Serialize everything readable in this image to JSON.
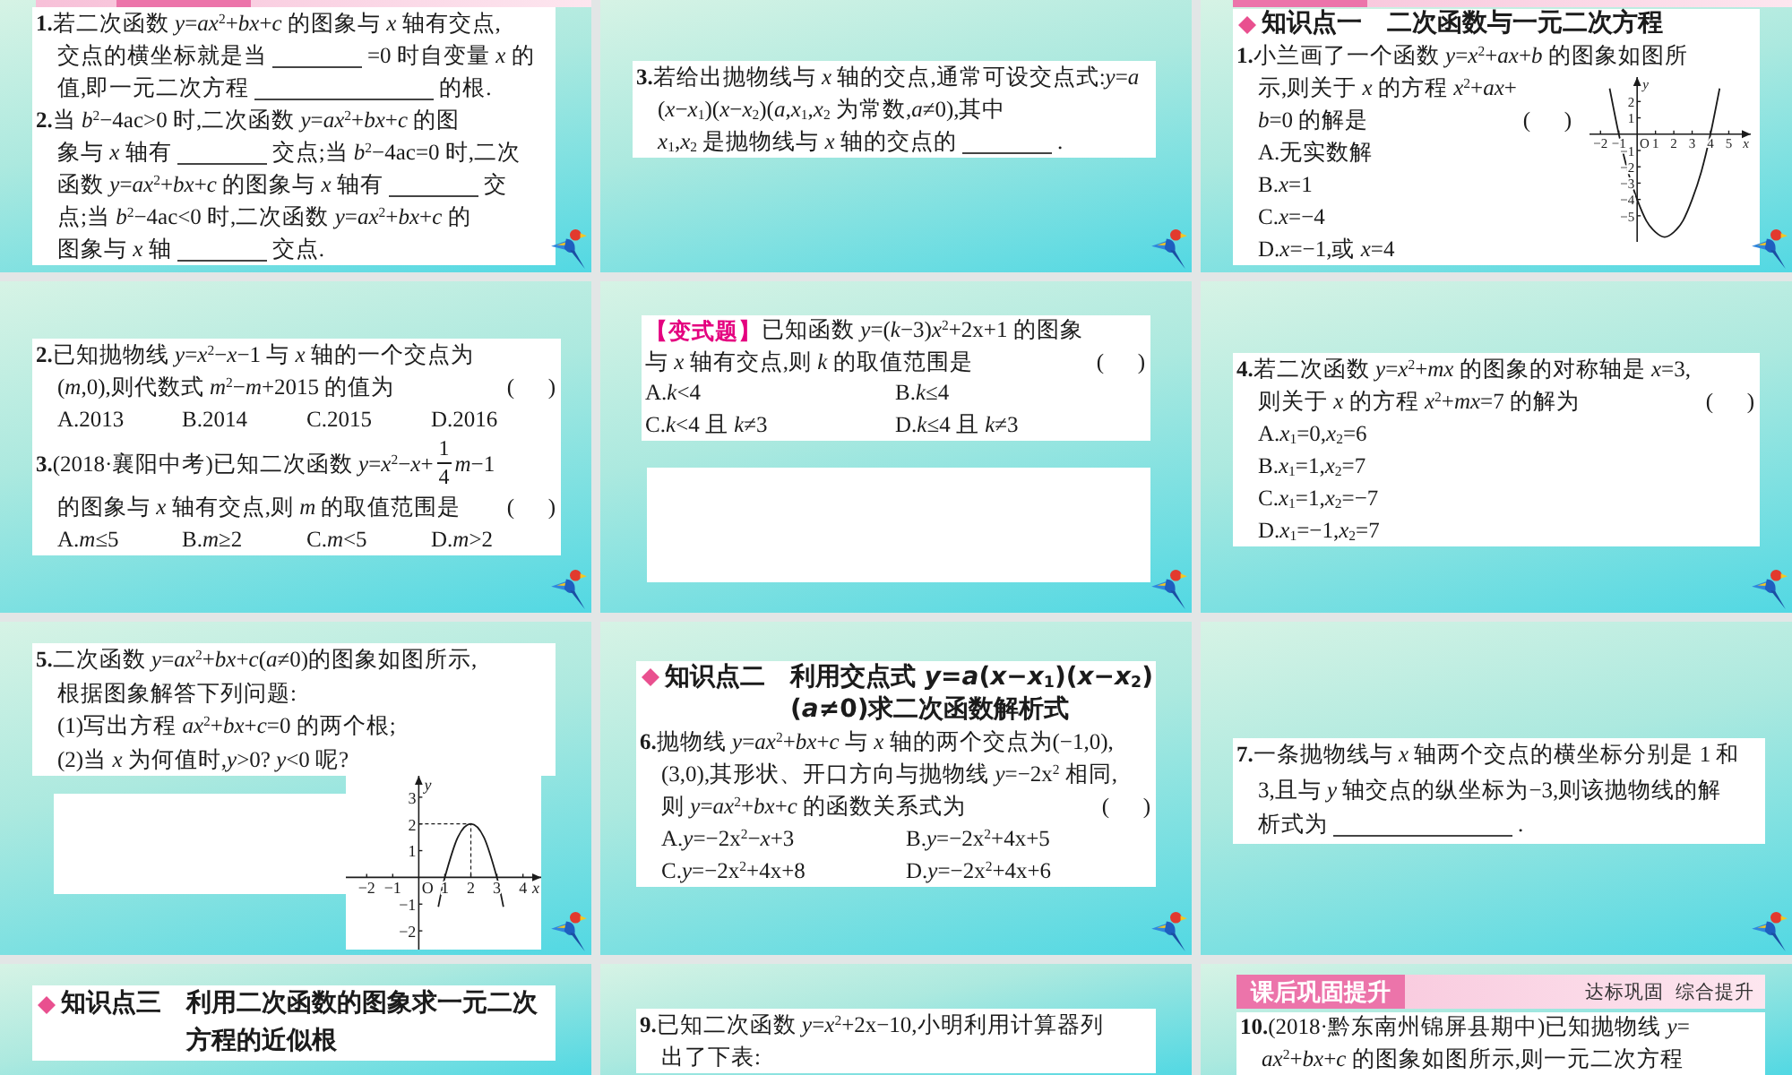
{
  "slides": [
    {
      "logo": true,
      "blocks": [
        {
          "kind": "banner"
        },
        {
          "kind": "panel",
          "items": [
            {
              "kind": "question",
              "lines": [
                {
                  "kind": "text",
                  "text": "**1.**若二次函数 *y*=*ax*$^{2}$+*bx*+*c* 的图象与 *x* 轴有交点,"
                },
                {
                  "kind": "parts",
                  "parts": [
                    {
                      "kind": "text",
                      "text": "交点的横坐标就是当"
                    },
                    {
                      "kind": "blank"
                    },
                    {
                      "kind": "text",
                      "text": "=0 时自变量 *x* 的"
                    }
                  ]
                },
                {
                  "kind": "parts",
                  "parts": [
                    {
                      "kind": "text",
                      "text": "值,即一元二次方程"
                    },
                    {
                      "kind": "longblank"
                    },
                    {
                      "kind": "text",
                      "text": "的根."
                    }
                  ]
                }
              ]
            },
            {
              "kind": "question",
              "lines": [
                {
                  "kind": "text",
                  "text": "**2.**当 *b*$^{2}$−4ac>0 时,二次函数 *y*=*ax*$^{2}$+*bx*+*c* 的图"
                },
                {
                  "kind": "parts",
                  "parts": [
                    {
                      "kind": "text",
                      "text": "象与 *x* 轴有"
                    },
                    {
                      "kind": "blank"
                    },
                    {
                      "kind": "text",
                      "text": "交点;当 *b*$^{2}$−4ac=0 时,二次"
                    }
                  ]
                },
                {
                  "kind": "parts",
                  "parts": [
                    {
                      "kind": "text",
                      "text": "函数 *y*=*ax*$^{2}$+*bx*+*c* 的图象与 *x* 轴有"
                    },
                    {
                      "kind": "blank"
                    },
                    {
                      "kind": "text",
                      "text": "交"
                    }
                  ]
                },
                {
                  "kind": "text",
                  "text": "点;当 *b*$^{2}$−4ac<0 时,二次函数 *y*=*ax*$^{2}$+*bx*+*c* 的"
                },
                {
                  "kind": "parts",
                  "parts": [
                    {
                      "kind": "text",
                      "text": "图象与 *x* 轴"
                    },
                    {
                      "kind": "blank"
                    },
                    {
                      "kind": "text",
                      "text": "交点."
                    }
                  ]
                }
              ]
            }
          ]
        }
      ]
    },
    {
      "logo": true,
      "blocks": [
        {
          "kind": "panel",
          "items": [
            {
              "kind": "question",
              "lines": [
                {
                  "kind": "text",
                  "text": "**3.**若给出抛物线与 *x* 轴的交点,通常可设交点式:*y*=*a*"
                },
                {
                  "kind": "text",
                  "text": "(*x*−*x*$_{1}$)(*x*−*x*$_{2}$)(*a*,*x*$_{1}$,*x*$_{2}$ 为常数,*a*≠0),其中"
                },
                {
                  "kind": "parts",
                  "parts": [
                    {
                      "kind": "text",
                      "text": "*x*$_{1}$,*x*$_{2}$ 是抛物线与 *x* 轴的交点的"
                    },
                    {
                      "kind": "blank"
                    },
                    {
                      "kind": "text",
                      "text": "."
                    }
                  ]
                }
              ]
            }
          ]
        }
      ]
    },
    {
      "logo": true,
      "blocks": [
        {
          "kind": "banner"
        },
        {
          "kind": "panel",
          "items": [
            {
              "kind": "heading",
              "label": "知识点一",
              "title": [
                "二次函数与一元二次方程"
              ]
            },
            {
              "kind": "question",
              "lines": [
                {
                  "kind": "text",
                  "text": "**1.**小兰画了一个函数 *y*=*x*$^{2}$+*ax*+*b* 的图象如图所"
                },
                {
                  "kind": "text",
                  "text": "示,则关于 *x* 的方程 *x*$^{2}$+*ax*+"
                },
                {
                  "kind": "choice",
                  "text": "*b*=0 的解是",
                  "bracket": "(      )"
                },
                {
                  "kind": "options",
                  "options": [
                    "A.无实数解"
                  ]
                },
                {
                  "kind": "options",
                  "options": [
                    "B.*x*=1"
                  ]
                },
                {
                  "kind": "options",
                  "options": [
                    "C.*x*=−4"
                  ]
                },
                {
                  "kind": "options",
                  "options": [
                    "D.*x*=−1,或 *x*=4"
                  ]
                }
              ],
              "figure": {
                "chart_data": {
                  "type": "line",
                  "xlabel": "x",
                  "ylabel": "y",
                  "x": [
                    -1.5,
                    -1,
                    -0.5,
                    0,
                    0.5,
                    1,
                    1.5,
                    2,
                    2.5,
                    3,
                    3.5,
                    4,
                    4.5
                  ],
                  "values": [
                    2.8,
                    0,
                    -2.3,
                    -4,
                    -5.3,
                    -6,
                    -6.3,
                    -6,
                    -5.3,
                    -4,
                    -2.3,
                    0,
                    2.8
                  ],
                  "xlim": [
                    -2.6,
                    6.2
                  ],
                  "ylim": [
                    -6.6,
                    3.5
                  ],
                  "xticks": [
                    {
                      "value": -2,
                      "label": "−2"
                    },
                    {
                      "value": -1,
                      "label": "−1"
                    },
                    {
                      "value": 0,
                      "label": "O"
                    },
                    {
                      "value": 1,
                      "label": "1"
                    },
                    {
                      "value": 2,
                      "label": "2"
                    },
                    {
                      "value": 3,
                      "label": "3"
                    },
                    {
                      "value": 4,
                      "label": "4"
                    },
                    {
                      "value": 5,
                      "label": "5"
                    }
                  ],
                  "yticks": [
                    {
                      "value": 2,
                      "label": "2"
                    },
                    {
                      "value": 1,
                      "label": "1"
                    },
                    {
                      "value": -1,
                      "label": "−1"
                    },
                    {
                      "value": -2,
                      "label": "−2"
                    },
                    {
                      "value": -3,
                      "label": "−3"
                    },
                    {
                      "value": -4,
                      "label": "−4"
                    },
                    {
                      "value": -5,
                      "label": "−5"
                    }
                  ]
                }
              }
            }
          ]
        }
      ]
    },
    {
      "logo": true,
      "blocks": [
        {
          "kind": "panel",
          "items": [
            {
              "kind": "question",
              "lines": [
                {
                  "kind": "text",
                  "text": "**2.**已知抛物线 *y*=*x*$^{2}$−*x*−1 与 *x* 轴的一个交点为"
                },
                {
                  "kind": "choice",
                  "text": "(*m*,0),则代数式 *m*$^{2}$−*m*+2015 的值为",
                  "bracket": "(      )"
                },
                {
                  "kind": "options",
                  "options": [
                    "A.2013",
                    "B.2014",
                    "C.2015",
                    "D.2016"
                  ]
                }
              ]
            },
            {
              "kind": "question",
              "lines": [
                {
                  "kind": "parts",
                  "parts": [
                    {
                      "kind": "text",
                      "text": "**3.**(2018·襄阳中考)已知二次函数 *y*=*x*$^{2}$−*x*+"
                    },
                    {
                      "kind": "fraction",
                      "numerator": "1",
                      "denominator": "4"
                    },
                    {
                      "kind": "text",
                      "text": "*m*−1"
                    }
                  ]
                },
                {
                  "kind": "choice",
                  "text": "的图象与 *x* 轴有交点,则 *m* 的取值范围是",
                  "bracket": "(      )"
                },
                {
                  "kind": "options",
                  "options": [
                    "A.*m*≤5",
                    "B.*m*≥2",
                    "C.*m*<5",
                    "D.*m*>2"
                  ]
                }
              ]
            }
          ]
        }
      ]
    },
    {
      "logo": true,
      "blocks": [
        {
          "kind": "panel",
          "items": [
            {
              "kind": "variant",
              "tag": "【变式题】",
              "lines": [
                {
                  "kind": "text",
                  "text": "已知函数 *y*=(*k*−3)*x*$^{2}$+2x+1 的图象"
                },
                {
                  "kind": "choice",
                  "text": "与 *x* 轴有交点,则 *k* 的取值范围是",
                  "bracket": "(      )"
                },
                {
                  "kind": "options",
                  "options": [
                    "A.*k*<4",
                    "B.*k*≤4"
                  ]
                },
                {
                  "kind": "options",
                  "options": [
                    "C.*k*<4 且 *k*≠3",
                    "D.*k*≤4 且 *k*≠3"
                  ]
                }
              ]
            }
          ]
        },
        {
          "kind": "answer-box"
        }
      ]
    },
    {
      "logo": true,
      "blocks": [
        {
          "kind": "panel",
          "items": [
            {
              "kind": "question",
              "lines": [
                {
                  "kind": "text",
                  "text": "**4.**若二次函数 *y*=*x*$^{2}$+*mx* 的图象的对称轴是 *x*=3,"
                },
                {
                  "kind": "choice",
                  "text": "则关于 *x* 的方程 *x*$^{2}$+*mx*=7 的解为",
                  "bracket": "(      )"
                },
                {
                  "kind": "options",
                  "options": [
                    "A.*x*$_{1}$=0,*x*$_{2}$=6"
                  ]
                },
                {
                  "kind": "options",
                  "options": [
                    "B.*x*$_{1}$=1,*x*$_{2}$=7"
                  ]
                },
                {
                  "kind": "options",
                  "options": [
                    "C.*x*$_{1}$=1,*x*$_{2}$=−7"
                  ]
                },
                {
                  "kind": "options",
                  "options": [
                    "D.*x*$_{1}$=−1,*x*$_{2}$=7"
                  ]
                }
              ]
            }
          ]
        }
      ]
    },
    {
      "logo": true,
      "blocks": [
        {
          "kind": "panel",
          "items": [
            {
              "kind": "question",
              "lines": [
                {
                  "kind": "text",
                  "text": "**5.**二次函数 *y*=*ax*$^{2}$+*bx*+*c*(*a*≠0)的图象如图所示,"
                },
                {
                  "kind": "text",
                  "text": "根据图象解答下列问题:"
                },
                {
                  "kind": "text",
                  "text": "(1)写出方程 *ax*$^{2}$+*bx*+*c*=0 的两个根;"
                },
                {
                  "kind": "text",
                  "text": "(2)当 *x* 为何值时,*y*>0? *y*<0 呢?"
                }
              ]
            }
          ]
        },
        {
          "kind": "work",
          "figure": {
            "chart_data": {
              "type": "line",
              "xlabel": "x",
              "ylabel": "y",
              "x": [
                0.75,
                1,
                1.5,
                2,
                2.5,
                3,
                3.25
              ],
              "values": [
                -1.1,
                0,
                1.5,
                2,
                1.5,
                0,
                -1.1
              ],
              "xlim": [
                -2.8,
                4.7
              ],
              "ylim": [
                -2.7,
                3.8
              ],
              "xticks": [
                {
                  "value": -2,
                  "label": "−2"
                },
                {
                  "value": -1,
                  "label": "−1"
                },
                {
                  "value": 0,
                  "label": "O"
                },
                {
                  "value": 1,
                  "label": "1"
                },
                {
                  "value": 2,
                  "label": "2"
                },
                {
                  "value": 3,
                  "label": "3"
                },
                {
                  "value": 4,
                  "label": "4"
                }
              ],
              "yticks": [
                {
                  "value": 3,
                  "label": "3"
                },
                {
                  "value": 2,
                  "label": "2"
                },
                {
                  "value": 1,
                  "label": "1"
                },
                {
                  "value": -1,
                  "label": "−1"
                },
                {
                  "value": -2,
                  "label": "−2"
                }
              ],
              "ref_lines": [
                {
                  "axis": "y",
                  "value": 2
                }
              ]
            }
          }
        }
      ]
    },
    {
      "logo": true,
      "blocks": [
        {
          "kind": "panel",
          "items": [
            {
              "kind": "heading",
              "label": "知识点二",
              "title": [
                "利用交点式 *y*=*a*(*x*−*x*$_{1}$)(*x*−*x*$_{2}$)",
                "(*a*≠0)求二次函数解析式"
              ]
            },
            {
              "kind": "question",
              "lines": [
                {
                  "kind": "text",
                  "text": "**6.**抛物线 *y*=*ax*$^{2}$+*bx*+*c* 与 *x* 轴的两个交点为(−1,0),"
                },
                {
                  "kind": "text",
                  "text": "(3,0),其形状、开口方向与抛物线 *y*=−2x$^{2}$ 相同,"
                },
                {
                  "kind": "choice",
                  "text": "则 *y*=*ax*$^{2}$+*bx*+*c* 的函数关系式为",
                  "bracket": "(      )"
                },
                {
                  "kind": "options",
                  "options": [
                    "A.*y*=−2x$^{2}$−*x*+3",
                    "B.*y*=−2x$^{2}$+4x+5"
                  ]
                },
                {
                  "kind": "options",
                  "options": [
                    "C.*y*=−2x$^{2}$+4x+8",
                    "D.*y*=−2x$^{2}$+4x+6"
                  ]
                }
              ]
            }
          ]
        }
      ]
    },
    {
      "logo": true,
      "blocks": [
        {
          "kind": "panel",
          "items": [
            {
              "kind": "question",
              "lines": [
                {
                  "kind": "text",
                  "text": "**7.**一条抛物线与 *x* 轴两个交点的横坐标分别是 1 和"
                },
                {
                  "kind": "text",
                  "text": "3,且与 *y* 轴交点的纵坐标为−3,则该抛物线的解"
                },
                {
                  "kind": "parts",
                  "parts": [
                    {
                      "kind": "text",
                      "text": "析式为"
                    },
                    {
                      "kind": "longblank"
                    },
                    {
                      "kind": "text",
                      "text": "."
                    }
                  ]
                }
              ]
            }
          ]
        }
      ]
    },
    {
      "blocks": [
        {
          "kind": "panel",
          "items": [
            {
              "kind": "heading",
              "label": "知识点三",
              "title": [
                "利用二次函数的图象求一元二次",
                "方程的近似根"
              ]
            }
          ]
        }
      ]
    },
    {
      "blocks": [
        {
          "kind": "panel",
          "items": [
            {
              "kind": "question",
              "lines": [
                {
                  "kind": "text",
                  "text": "**9.**已知二次函数 *y*=*x*$^{2}$+2x−10,小明利用计算器列"
                },
                {
                  "kind": "text",
                  "text": "出了下表:"
                }
              ]
            }
          ]
        }
      ]
    },
    {
      "blocks": [
        {
          "kind": "banner",
          "title": "课后巩固提升",
          "subtitle": "达标巩固  综合提升"
        },
        {
          "kind": "panel",
          "items": [
            {
              "kind": "question",
              "lines": [
                {
                  "kind": "text",
                  "text": "**10.**(2018·黔东南州锦屏县期中)已知抛物线 *y*="
                },
                {
                  "kind": "text",
                  "text": "*ax*$^{2}$+*bx*+*c* 的图象如图所示,则一元二次方程"
                }
              ]
            }
          ]
        }
      ]
    }
  ]
}
